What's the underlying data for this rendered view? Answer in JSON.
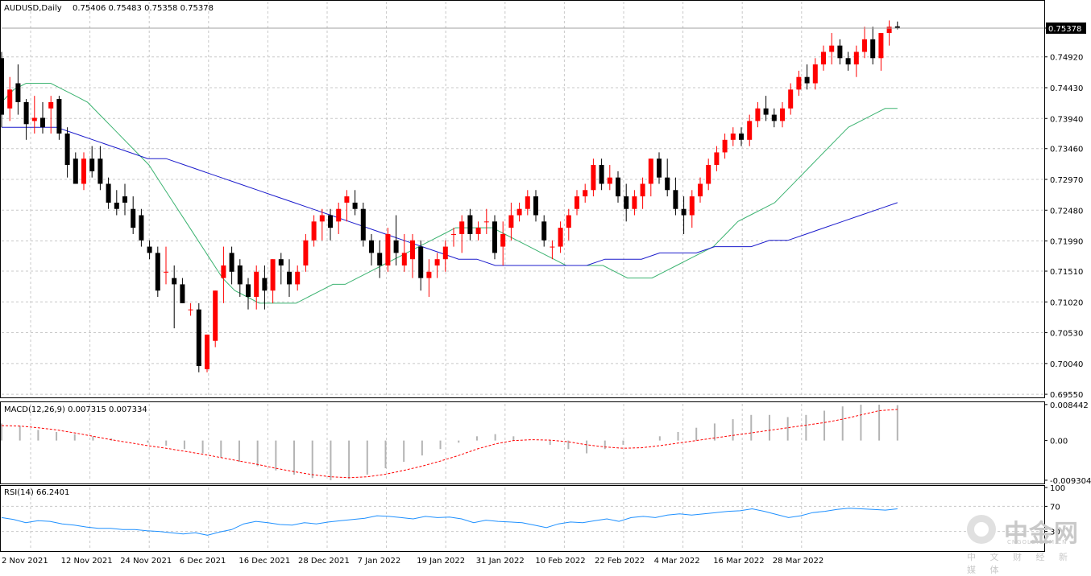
{
  "main_header": {
    "symbol_period": "AUDUSD,Daily",
    "ohlc": "0.75406 0.75483 0.75358 0.75378"
  },
  "macd_header": "MACD(12,26,9) 0.007315 0.007334",
  "rsi_header": "RSI(14) 66.2401",
  "watermark": {
    "brand": "中金网",
    "domain": "CNGOLD.COM.CN",
    "tagline": "中 文 财 经 新 媒 体"
  },
  "colors": {
    "bull": "#ff0000",
    "bear": "#000000",
    "ma_fast": "#3cb371",
    "ma_slow": "#1c1ccc",
    "macd_signal": "#ff0000",
    "macd_hist": "#b4b4b4",
    "rsi": "#1e90ff",
    "grid": "#c8c8c8"
  },
  "chart_data": [
    {
      "type": "candlestick",
      "title": "AUDUSD,Daily",
      "x_tick_labels": [
        "2 Nov 2021",
        "12 Nov 2021",
        "24 Nov 2021",
        "6 Dec 2021",
        "16 Dec 2021",
        "28 Dec 2021",
        "7 Jan 2022",
        "19 Jan 2022",
        "31 Jan 2022",
        "10 Feb 2022",
        "22 Feb 2022",
        "4 Mar 2022",
        "16 Mar 2022",
        "28 Mar 2022"
      ],
      "y_tick_labels": [
        "0.75378",
        "0.74920",
        "0.74430",
        "0.73940",
        "0.73460",
        "0.72970",
        "0.72480",
        "0.71990",
        "0.71510",
        "0.71020",
        "0.70530",
        "0.70040",
        "0.69550"
      ],
      "ylim": [
        0.695,
        0.758
      ],
      "current_price": "0.75378",
      "ohlc": [
        [
          0.749,
          0.75,
          0.738,
          0.74
        ],
        [
          0.741,
          0.746,
          0.739,
          0.744
        ],
        [
          0.745,
          0.748,
          0.74,
          0.742
        ],
        [
          0.742,
          0.7425,
          0.736,
          0.7385
        ],
        [
          0.739,
          0.743,
          0.737,
          0.7395
        ],
        [
          0.7395,
          0.742,
          0.737,
          0.738
        ],
        [
          0.741,
          0.743,
          0.737,
          0.742
        ],
        [
          0.7425,
          0.743,
          0.736,
          0.737
        ],
        [
          0.737,
          0.738,
          0.73,
          0.732
        ],
        [
          0.733,
          0.734,
          0.729,
          0.729
        ],
        [
          0.729,
          0.734,
          0.728,
          0.733
        ],
        [
          0.733,
          0.735,
          0.73,
          0.731
        ],
        [
          0.733,
          0.735,
          0.728,
          0.729
        ],
        [
          0.729,
          0.73,
          0.725,
          0.726
        ],
        [
          0.726,
          0.728,
          0.724,
          0.725
        ],
        [
          0.727,
          0.729,
          0.724,
          0.726
        ],
        [
          0.725,
          0.727,
          0.721,
          0.722
        ],
        [
          0.724,
          0.725,
          0.719,
          0.72
        ],
        [
          0.719,
          0.72,
          0.717,
          0.718
        ],
        [
          0.718,
          0.719,
          0.711,
          0.712
        ],
        [
          0.715,
          0.719,
          0.713,
          0.715
        ],
        [
          0.714,
          0.716,
          0.706,
          0.713
        ],
        [
          0.713,
          0.714,
          0.71,
          0.71
        ],
        [
          0.709,
          0.71,
          0.708,
          0.709
        ],
        [
          0.709,
          0.71,
          0.699,
          0.7
        ],
        [
          0.6995,
          0.705,
          0.699,
          0.705
        ],
        [
          0.704,
          0.712,
          0.703,
          0.712
        ],
        [
          0.714,
          0.719,
          0.71,
          0.716
        ],
        [
          0.718,
          0.719,
          0.713,
          0.715
        ],
        [
          0.716,
          0.717,
          0.711,
          0.713
        ],
        [
          0.713,
          0.714,
          0.709,
          0.711
        ],
        [
          0.711,
          0.716,
          0.709,
          0.715
        ],
        [
          0.714,
          0.716,
          0.709,
          0.712
        ],
        [
          0.712,
          0.717,
          0.71,
          0.717
        ],
        [
          0.717,
          0.718,
          0.713,
          0.716
        ],
        [
          0.715,
          0.717,
          0.711,
          0.713
        ],
        [
          0.713,
          0.716,
          0.712,
          0.715
        ],
        [
          0.716,
          0.721,
          0.715,
          0.72
        ],
        [
          0.72,
          0.724,
          0.719,
          0.723
        ],
        [
          0.723,
          0.725,
          0.72,
          0.724
        ],
        [
          0.724,
          0.725,
          0.72,
          0.722
        ],
        [
          0.723,
          0.726,
          0.721,
          0.725
        ],
        [
          0.726,
          0.728,
          0.723,
          0.727
        ],
        [
          0.726,
          0.728,
          0.724,
          0.725
        ],
        [
          0.725,
          0.726,
          0.719,
          0.72
        ],
        [
          0.72,
          0.721,
          0.716,
          0.718
        ],
        [
          0.718,
          0.72,
          0.714,
          0.716
        ],
        [
          0.716,
          0.722,
          0.715,
          0.721
        ],
        [
          0.72,
          0.724,
          0.716,
          0.718
        ],
        [
          0.716,
          0.721,
          0.715,
          0.718
        ],
        [
          0.717,
          0.721,
          0.714,
          0.72
        ],
        [
          0.719,
          0.72,
          0.712,
          0.714
        ],
        [
          0.714,
          0.717,
          0.711,
          0.715
        ],
        [
          0.716,
          0.718,
          0.714,
          0.717
        ],
        [
          0.717,
          0.72,
          0.715,
          0.719
        ],
        [
          0.721,
          0.722,
          0.719,
          0.721
        ],
        [
          0.721,
          0.724,
          0.718,
          0.723
        ],
        [
          0.724,
          0.725,
          0.72,
          0.721
        ],
        [
          0.721,
          0.723,
          0.72,
          0.722
        ],
        [
          0.723,
          0.725,
          0.721,
          0.723
        ],
        [
          0.723,
          0.724,
          0.717,
          0.718
        ],
        [
          0.719,
          0.723,
          0.716,
          0.721
        ],
        [
          0.722,
          0.726,
          0.72,
          0.724
        ],
        [
          0.724,
          0.726,
          0.723,
          0.725
        ],
        [
          0.725,
          0.728,
          0.724,
          0.727
        ],
        [
          0.727,
          0.728,
          0.723,
          0.724
        ],
        [
          0.723,
          0.724,
          0.719,
          0.72
        ],
        [
          0.719,
          0.72,
          0.717,
          0.719
        ],
        [
          0.719,
          0.723,
          0.718,
          0.722
        ],
        [
          0.722,
          0.725,
          0.72,
          0.724
        ],
        [
          0.725,
          0.728,
          0.724,
          0.727
        ],
        [
          0.727,
          0.729,
          0.726,
          0.728
        ],
        [
          0.728,
          0.733,
          0.727,
          0.732
        ],
        [
          0.732,
          0.733,
          0.728,
          0.729
        ],
        [
          0.729,
          0.732,
          0.728,
          0.73
        ],
        [
          0.73,
          0.731,
          0.726,
          0.727
        ],
        [
          0.727,
          0.729,
          0.723,
          0.725
        ],
        [
          0.725,
          0.728,
          0.724,
          0.727
        ],
        [
          0.727,
          0.73,
          0.725,
          0.729
        ],
        [
          0.729,
          0.733,
          0.727,
          0.733
        ],
        [
          0.733,
          0.734,
          0.729,
          0.73
        ],
        [
          0.73,
          0.733,
          0.727,
          0.728
        ],
        [
          0.728,
          0.73,
          0.724,
          0.725
        ],
        [
          0.725,
          0.727,
          0.721,
          0.724
        ],
        [
          0.724,
          0.728,
          0.722,
          0.727
        ],
        [
          0.727,
          0.73,
          0.726,
          0.729
        ],
        [
          0.729,
          0.733,
          0.728,
          0.732
        ],
        [
          0.732,
          0.735,
          0.731,
          0.734
        ],
        [
          0.734,
          0.737,
          0.733,
          0.736
        ],
        [
          0.736,
          0.738,
          0.735,
          0.737
        ],
        [
          0.737,
          0.738,
          0.735,
          0.736
        ],
        [
          0.736,
          0.74,
          0.735,
          0.739
        ],
        [
          0.739,
          0.742,
          0.738,
          0.741
        ],
        [
          0.741,
          0.743,
          0.739,
          0.74
        ],
        [
          0.74,
          0.741,
          0.738,
          0.739
        ],
        [
          0.739,
          0.742,
          0.738,
          0.741
        ],
        [
          0.741,
          0.745,
          0.74,
          0.744
        ],
        [
          0.744,
          0.747,
          0.743,
          0.746
        ],
        [
          0.746,
          0.748,
          0.744,
          0.745
        ],
        [
          0.745,
          0.749,
          0.744,
          0.748
        ],
        [
          0.748,
          0.751,
          0.747,
          0.75
        ],
        [
          0.75,
          0.753,
          0.748,
          0.751
        ],
        [
          0.751,
          0.752,
          0.748,
          0.749
        ],
        [
          0.749,
          0.75,
          0.747,
          0.748
        ],
        [
          0.748,
          0.751,
          0.746,
          0.75
        ],
        [
          0.75,
          0.754,
          0.749,
          0.752
        ],
        [
          0.752,
          0.754,
          0.748,
          0.749
        ],
        [
          0.749,
          0.753,
          0.747,
          0.753
        ],
        [
          0.753,
          0.755,
          0.751,
          0.754
        ],
        [
          0.75406,
          0.75483,
          0.75358,
          0.75378
        ]
      ],
      "series": [
        {
          "values": [
            0.742,
            0.744,
            0.745,
            0.745,
            0.745,
            0.744,
            0.743,
            0.742,
            0.74,
            0.738,
            0.736,
            0.734,
            0.732,
            0.729,
            0.726,
            0.723,
            0.72,
            0.717,
            0.714,
            0.712,
            0.711,
            0.71,
            0.71,
            0.71,
            0.71,
            0.711,
            0.712,
            0.713,
            0.713,
            0.714,
            0.715,
            0.716,
            0.717,
            0.718,
            0.719,
            0.72,
            0.721,
            0.722,
            0.722,
            0.722,
            0.722,
            0.721,
            0.72,
            0.719,
            0.718,
            0.717,
            0.716,
            0.716,
            0.716,
            0.716,
            0.715,
            0.714,
            0.714,
            0.714,
            0.715,
            0.716,
            0.717,
            0.718,
            0.719,
            0.721,
            0.723,
            0.724,
            0.725,
            0.726,
            0.728,
            0.73,
            0.732,
            0.734,
            0.736,
            0.738,
            0.739,
            0.74,
            0.741,
            0.741
          ]
        },
        {
          "values": [
            0.738,
            0.738,
            0.738,
            0.738,
            0.737,
            0.736,
            0.735,
            0.734,
            0.733,
            0.733,
            0.732,
            0.731,
            0.73,
            0.729,
            0.728,
            0.727,
            0.726,
            0.725,
            0.724,
            0.723,
            0.722,
            0.721,
            0.72,
            0.719,
            0.718,
            0.717,
            0.717,
            0.716,
            0.716,
            0.716,
            0.716,
            0.716,
            0.716,
            0.717,
            0.717,
            0.717,
            0.718,
            0.718,
            0.718,
            0.719,
            0.719,
            0.719,
            0.72,
            0.72,
            0.721,
            0.722,
            0.723,
            0.724,
            0.725,
            0.726
          ]
        }
      ]
    },
    {
      "type": "bar",
      "title": "MACD(12,26,9) 0.007315 0.007334",
      "y_tick_labels": [
        "0.008442",
        "0.00",
        "-0.009304"
      ],
      "ylim": [
        -0.0095,
        0.0086
      ],
      "series": [
        {
          "values": [
            0.004,
            0.0035,
            0.0025,
            0.002,
            0.0015,
            0.001,
            0.0005,
            0.0,
            -0.0005,
            -0.0012,
            -0.002,
            -0.003,
            -0.004,
            -0.005,
            -0.006,
            -0.007,
            -0.008,
            -0.0088,
            -0.0093,
            -0.009,
            -0.008,
            -0.0065,
            -0.005,
            -0.0035,
            -0.002,
            -0.0005,
            0.001,
            0.0015,
            0.001,
            0.0,
            -0.001,
            -0.002,
            -0.003,
            -0.002,
            -0.001,
            0.0,
            0.001,
            0.002,
            0.003,
            0.004,
            0.005,
            0.006,
            0.006,
            0.0055,
            0.006,
            0.007,
            0.008,
            0.0084,
            0.0084,
            0.0083
          ]
        },
        {
          "values": [
            0.0035,
            0.0034,
            0.003,
            0.0025,
            0.0018,
            0.001,
            0.0002,
            -0.0005,
            -0.0012,
            -0.0018,
            -0.0025,
            -0.0032,
            -0.004,
            -0.0048,
            -0.0056,
            -0.0065,
            -0.0073,
            -0.008,
            -0.0085,
            -0.0087,
            -0.0085,
            -0.0079,
            -0.007,
            -0.006,
            -0.0048,
            -0.0035,
            -0.002,
            -0.0008,
            0.0,
            0.0002,
            0.0001,
            -0.0003,
            -0.001,
            -0.0015,
            -0.0018,
            -0.0017,
            -0.0012,
            -0.0006,
            0.0,
            0.0006,
            0.0012,
            0.0018,
            0.0024,
            0.003,
            0.0036,
            0.0042,
            0.005,
            0.006,
            0.007,
            0.0073
          ]
        }
      ]
    },
    {
      "type": "line",
      "title": "RSI(14) 66.2401",
      "y_tick_labels": [
        "100",
        "70",
        "30"
      ],
      "ylim": [
        0,
        100
      ],
      "series": [
        {
          "values": [
            52,
            49,
            44,
            47,
            46,
            42,
            40,
            37,
            35,
            35,
            33,
            33,
            31,
            30,
            28,
            26,
            28,
            24,
            29,
            33,
            42,
            46,
            44,
            41,
            40,
            44,
            42,
            45,
            47,
            49,
            51,
            55,
            54,
            52,
            50,
            54,
            52,
            53,
            50,
            44,
            48,
            46,
            45,
            44,
            40,
            36,
            42,
            45,
            44,
            47,
            50,
            46,
            52,
            54,
            52,
            56,
            58,
            56,
            58,
            60,
            62,
            63,
            66,
            62,
            57,
            52,
            55,
            60,
            62,
            65,
            67,
            66,
            65,
            64,
            66
          ]
        }
      ]
    }
  ]
}
